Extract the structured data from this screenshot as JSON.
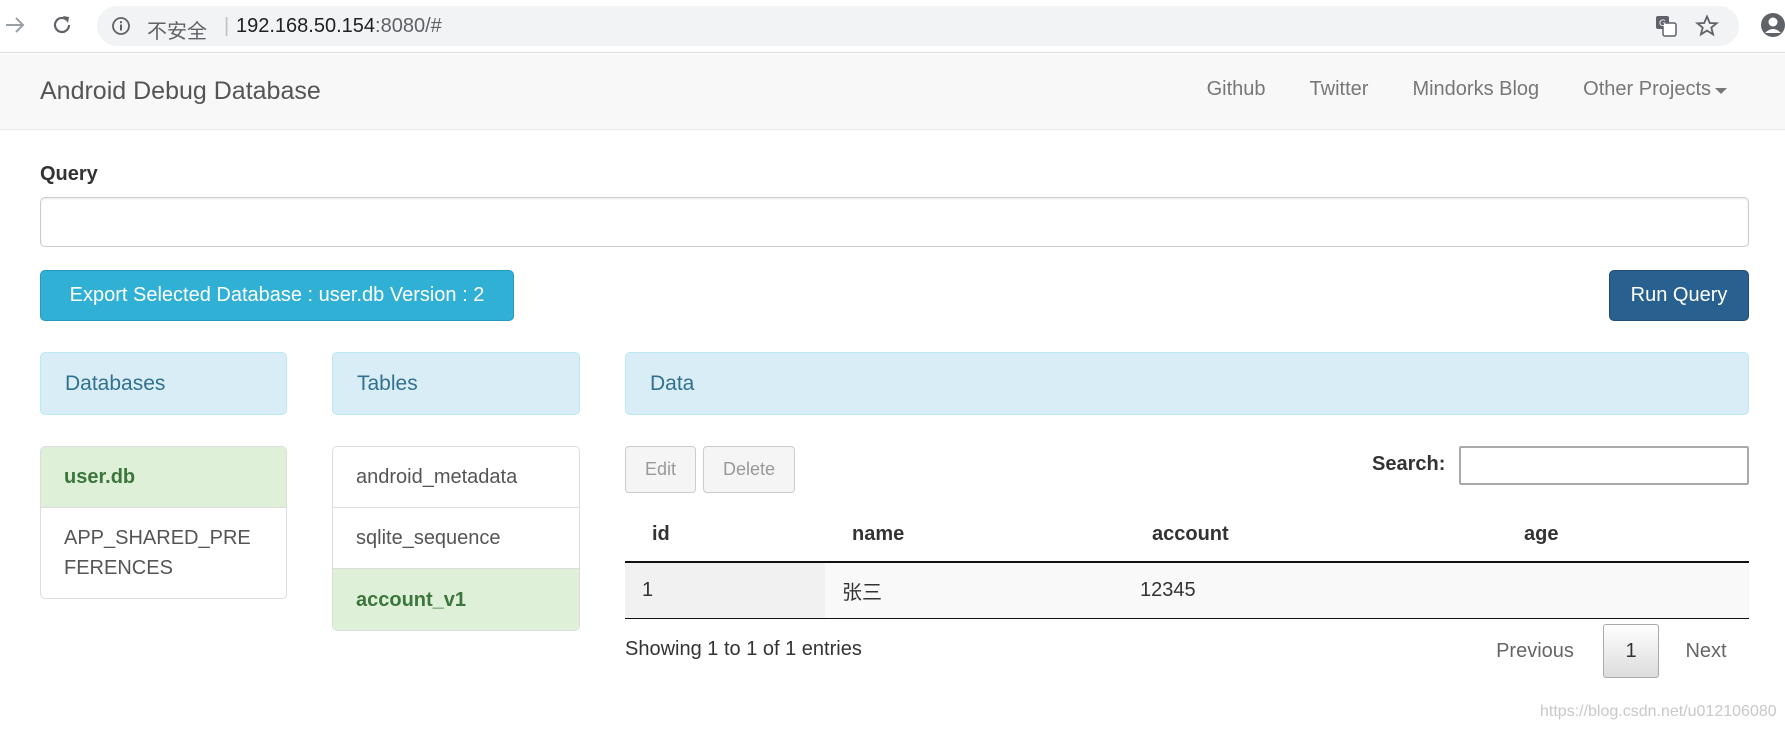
{
  "browser": {
    "security_text": "不安全",
    "separator": "|",
    "url_host": "192.168.50.154",
    "url_rest": ":8080/#"
  },
  "navbar": {
    "brand": "Android Debug Database",
    "links": [
      "Github",
      "Twitter",
      "Mindorks Blog",
      "Other Projects"
    ]
  },
  "query": {
    "label": "Query",
    "value": "",
    "placeholder": ""
  },
  "buttons": {
    "export": "Export Selected Database : user.db Version : 2",
    "run_query": "Run Query",
    "edit": "Edit",
    "delete": "Delete"
  },
  "panels": {
    "databases": "Databases",
    "tables": "Tables",
    "data": "Data"
  },
  "databases": [
    {
      "label": "user.db",
      "active": true
    },
    {
      "label": "APP_SHARED_PRE FERENCES",
      "active": false
    }
  ],
  "tables": [
    {
      "label": "android_metadata",
      "active": false
    },
    {
      "label": "sqlite_sequence",
      "active": false
    },
    {
      "label": "account_v1",
      "active": true
    }
  ],
  "data_table": {
    "search_label": "Search:",
    "columns": [
      "id",
      "name",
      "account",
      "age"
    ],
    "rows": [
      [
        "1",
        "张三",
        "12345",
        ""
      ]
    ],
    "info": "Showing 1 to 1 of 1 entries",
    "pagination": {
      "previous": "Previous",
      "current": "1",
      "next": "Next"
    }
  },
  "watermark": "https://blog.csdn.net/u012106080",
  "colors": {
    "export_button": "#31b0d5",
    "run_button": "#286090",
    "panel_header": "#d9edf7",
    "active_item": "#dff0d8"
  }
}
